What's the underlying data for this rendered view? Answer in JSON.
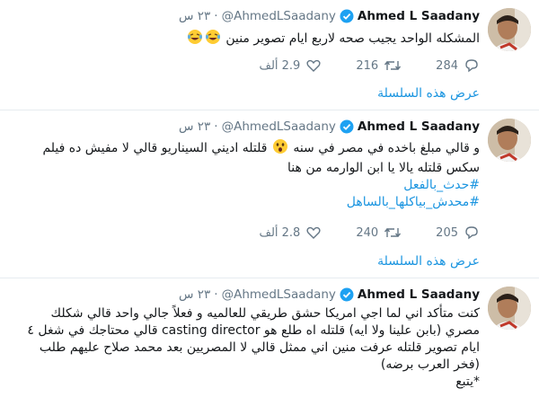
{
  "tweets": [
    {
      "name": "Ahmed L Saadany",
      "handle": "@AhmedLSaadany",
      "time": "٢٣ س",
      "lines": [
        "المشكله الواحد يجيب صحه لاربع ايام تصوير منين"
      ],
      "reply_count": "284",
      "retweet_count": "216",
      "like_count": "2.9 ألف",
      "thread_link": "عرض هذه السلسلة"
    },
    {
      "name": "Ahmed L Saadany",
      "handle": "@AhmedLSaadany",
      "time": "٢٣ س",
      "line1_a": "و قالي مبلغ باخده في مصر في سنه",
      "line1_b": "قلتله اديني السيناريو قالي لا مفيش ده فيلم",
      "line2": "سكس   قلتله يالا يا ابن الوارمه من هنا",
      "hashtags": [
        "#حدث_بالفعل",
        "#محدش_بياكلها_بالساهل"
      ],
      "reply_count": "205",
      "retweet_count": "240",
      "like_count": "2.8 ألف",
      "thread_link": "عرض هذه السلسلة"
    },
    {
      "name": "Ahmed L Saadany",
      "handle": "@AhmedLSaadany",
      "time": "٢٣ س",
      "lines": [
        "كنت متأكد اني لما اجي امريكا حشق طريقي للعالميه  و فعلاً جالي واحد قالي شكلك",
        "مصري (بابن علينا ولا ايه) قلتله اه طلع هو casting director قالي محتاجك في شغل ٤",
        "ايام تصوير  قلتله عرفت منين اني ممثل قالي لا المصريين بعد محمد صلاح عليهم طلب",
        "(فخر العرب برضه)",
        "*يتبع"
      ]
    }
  ]
}
